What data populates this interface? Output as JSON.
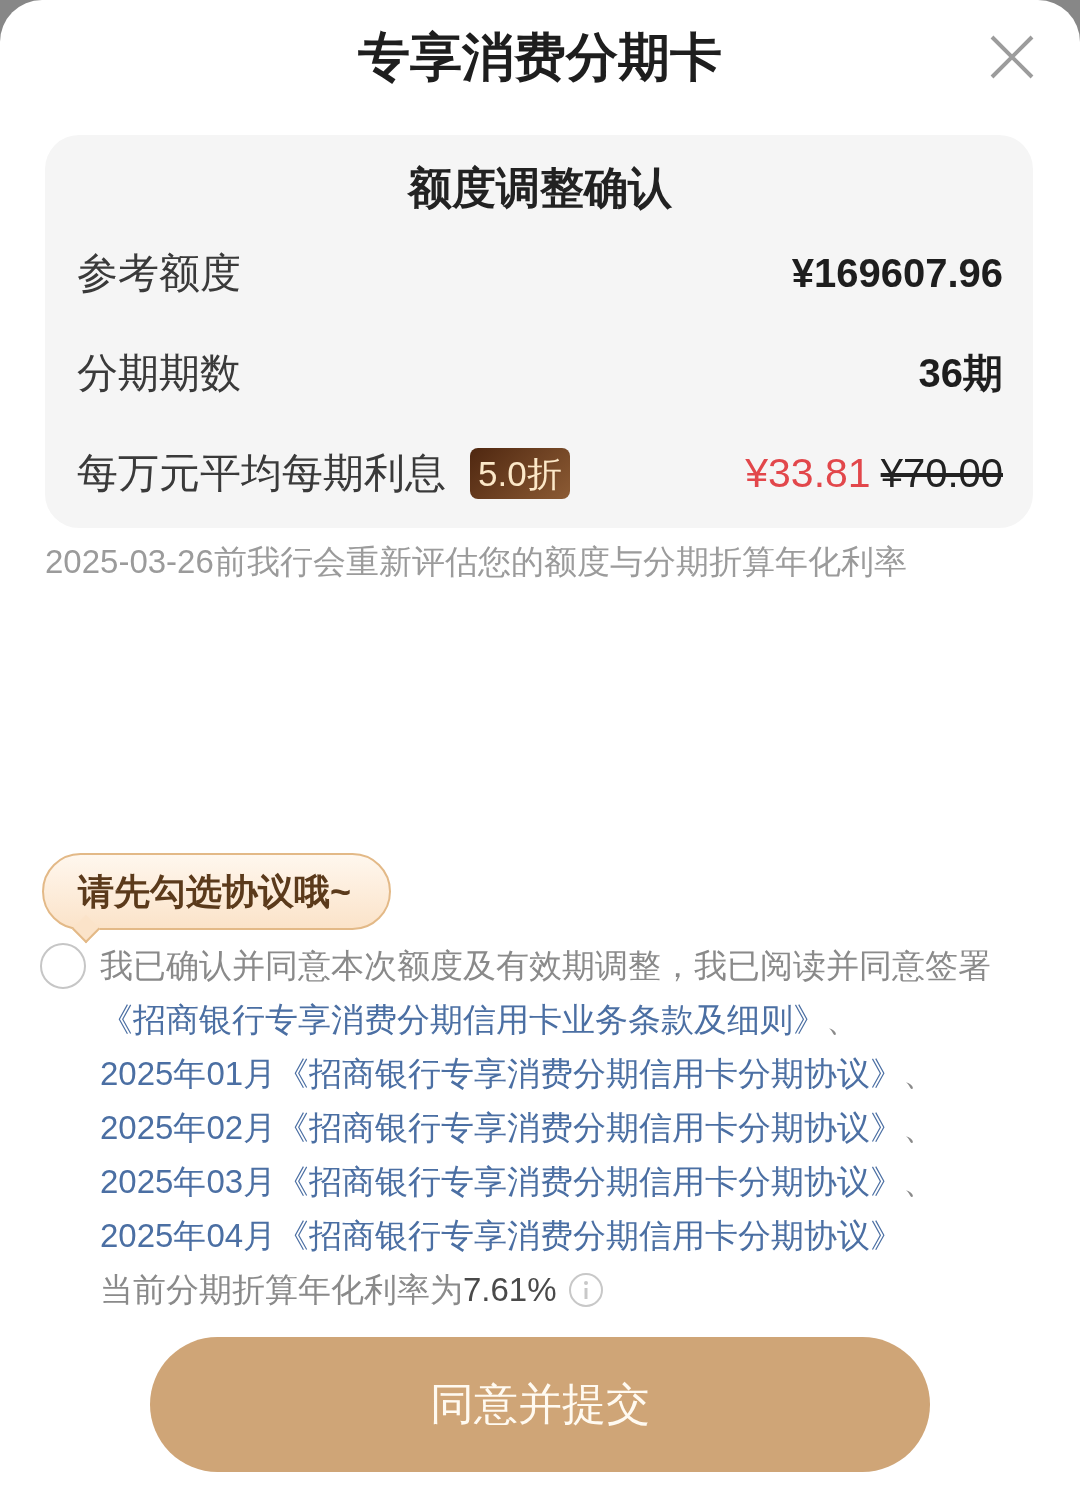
{
  "header": {
    "title": "专享消费分期卡"
  },
  "confirm_card": {
    "heading": "额度调整确认",
    "rows": [
      {
        "kind": "plain",
        "label": "参考额度",
        "value": "¥169607.96"
      },
      {
        "kind": "plain",
        "label": "分期期数",
        "value": "36期"
      },
      {
        "kind": "discount",
        "label": "每万元平均每期利息",
        "badge": "5.0折",
        "value": "¥33.81",
        "original_value": "¥70.00"
      }
    ]
  },
  "reassess_note": "2025-03-26前我行会重新评估您的额度与分期折算年化利率",
  "agreement": {
    "hint": "请先勾选协议哦~",
    "checked": false,
    "segments": [
      {
        "kind": "text",
        "text": "我已确认并同意本次额度及有效期调整，我已阅读并同意签署"
      },
      {
        "kind": "link",
        "text": "《招商银行专享消费分期信用卡业务条款及细则》"
      },
      {
        "kind": "text",
        "text": "、"
      },
      {
        "kind": "link",
        "text": "2025年01月《招商银行专享消费分期信用卡分期协议》"
      },
      {
        "kind": "text",
        "text": "、"
      },
      {
        "kind": "link",
        "text": "2025年02月《招商银行专享消费分期信用卡分期协议》"
      },
      {
        "kind": "text",
        "text": "、"
      },
      {
        "kind": "link",
        "text": "2025年03月《招商银行专享消费分期信用卡分期协议》"
      },
      {
        "kind": "text",
        "text": "、"
      },
      {
        "kind": "link",
        "text": "2025年04月《招商银行专享消费分期信用卡分期协议》"
      }
    ],
    "rate_text": "当前分期折算年化利率为**7.61%**"
  },
  "submit_button": "同意并提交"
}
